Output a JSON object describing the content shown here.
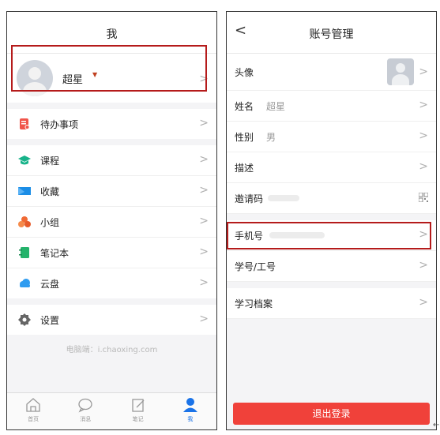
{
  "left": {
    "title": "我",
    "profile": {
      "name": "超星",
      "marker": "▼"
    },
    "todo": {
      "label": "待办事项"
    },
    "menu": [
      {
        "label": "课程",
        "icon": "course-icon",
        "color": "#18b38a"
      },
      {
        "label": "收藏",
        "icon": "bookmark-icon",
        "color": "#1b8de6"
      },
      {
        "label": "小组",
        "icon": "group-icon",
        "color": "#f06a35"
      },
      {
        "label": "笔记本",
        "icon": "notebook-icon",
        "color": "#24b36b"
      },
      {
        "label": "云盘",
        "icon": "cloud-icon",
        "color": "#2f9cf0"
      }
    ],
    "settings": {
      "label": "设置"
    },
    "footer": "电脑端：i.chaoxing.com",
    "tabs": [
      {
        "label": "首页",
        "icon": "home-icon"
      },
      {
        "label": "消息",
        "icon": "message-icon"
      },
      {
        "label": "笔记",
        "icon": "note-icon"
      },
      {
        "label": "我",
        "icon": "profile-icon"
      }
    ]
  },
  "right": {
    "title": "账号管理",
    "back": "<",
    "rows": {
      "avatar": {
        "label": "头像"
      },
      "name": {
        "label": "姓名",
        "value": "超星"
      },
      "gender": {
        "label": "性别",
        "value": "男"
      },
      "desc": {
        "label": "描述"
      },
      "invite": {
        "label": "邀请码"
      },
      "phone": {
        "label": "手机号"
      },
      "student_id": {
        "label": "学号/工号"
      },
      "archive": {
        "label": "学习档案"
      }
    },
    "logout": "退出登录"
  },
  "chevron": ">",
  "corner_mark": "←",
  "colors": {
    "accent": "#1a73e8",
    "highlight": "#b51b1b",
    "logout": "#f0413a"
  }
}
